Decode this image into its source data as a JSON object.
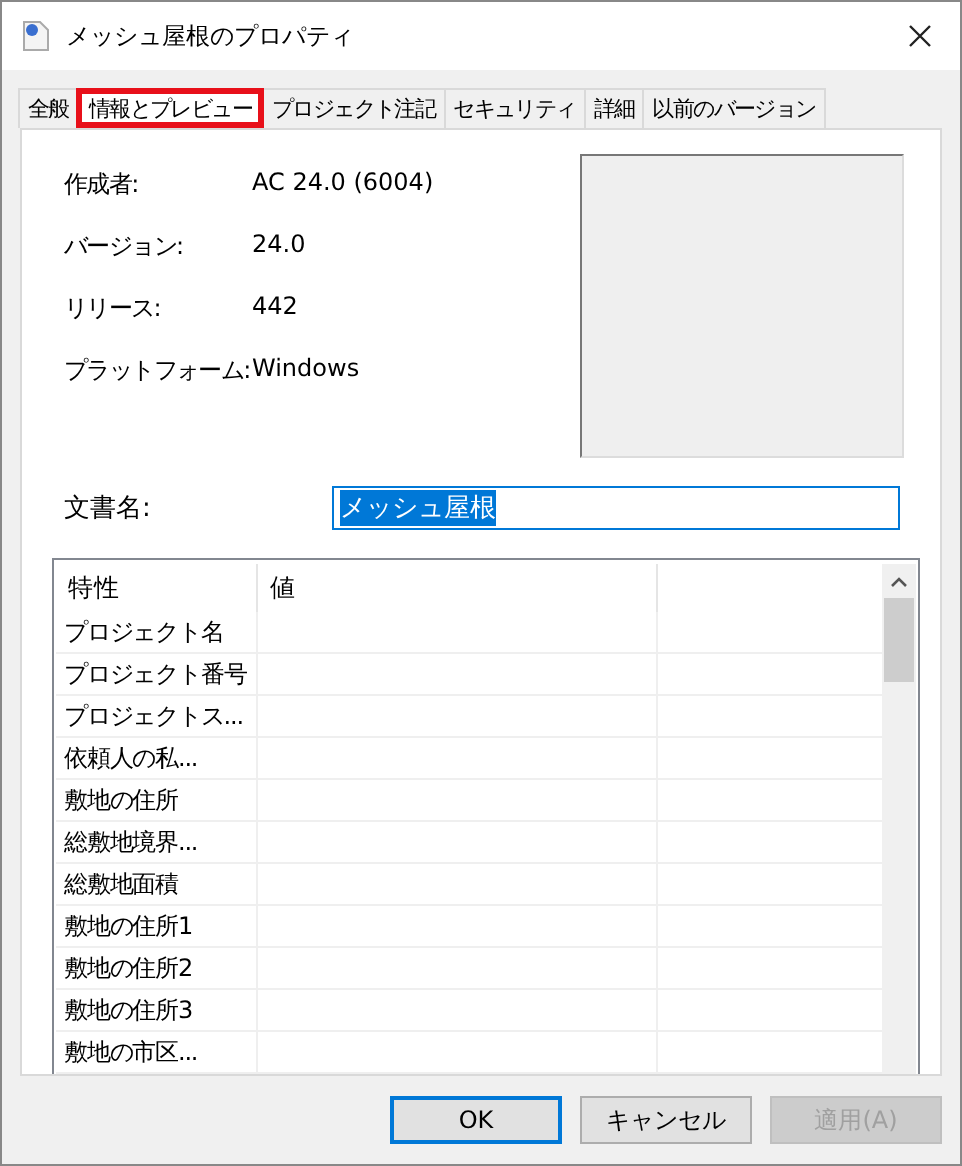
{
  "window": {
    "title": "メッシュ屋根のプロパティ"
  },
  "tabs": [
    {
      "label": "全般",
      "selected": false,
      "highlighted": false
    },
    {
      "label": "情報とプレビュー",
      "selected": true,
      "highlighted": true
    },
    {
      "label": "プロジェクト注記",
      "selected": false,
      "highlighted": false
    },
    {
      "label": "セキュリティ",
      "selected": false,
      "highlighted": false
    },
    {
      "label": "詳細",
      "selected": false,
      "highlighted": false
    },
    {
      "label": "以前のバージョン",
      "selected": false,
      "highlighted": false
    }
  ],
  "info": [
    {
      "label": "作成者:",
      "value": "AC 24.0 (6004)"
    },
    {
      "label": "バージョン:",
      "value": "24.0"
    },
    {
      "label": "リリース:",
      "value": "442"
    },
    {
      "label": "プラットフォーム:",
      "value": "Windows"
    }
  ],
  "document_name": {
    "label": "文書名:",
    "value": "メッシュ屋根",
    "selected": true
  },
  "table": {
    "columns": [
      "特性",
      "値"
    ],
    "rows": [
      {
        "property": "プロジェクト名"
      },
      {
        "property": "プロジェクト番号"
      },
      {
        "property": "プロジェクトス..."
      },
      {
        "property": "依頼人の私..."
      },
      {
        "property": "敷地の住所"
      },
      {
        "property": "総敷地境界..."
      },
      {
        "property": "総敷地面積"
      },
      {
        "property": "敷地の住所1"
      },
      {
        "property": "敷地の住所2"
      },
      {
        "property": "敷地の住所3"
      },
      {
        "property": "敷地の市区..."
      }
    ]
  },
  "buttons": [
    {
      "label": "OK",
      "default": true,
      "disabled": false
    },
    {
      "label": "キャンセル",
      "default": false,
      "disabled": false
    },
    {
      "label": "適用(A)",
      "default": false,
      "disabled": true
    }
  ]
}
